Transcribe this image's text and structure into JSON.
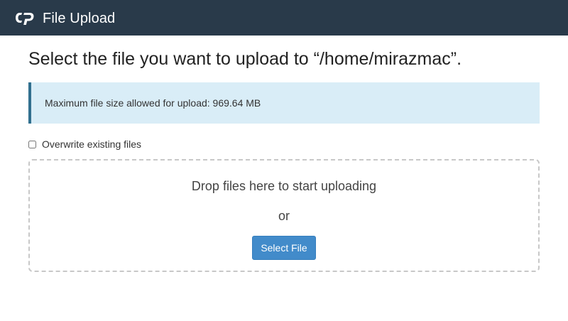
{
  "header": {
    "logo_icon": "cpanel-logo-icon",
    "title": "File Upload",
    "background_color": "#293a4a"
  },
  "main": {
    "page_title": "Select the file you want to upload to “/home/mirazmac”.",
    "info": {
      "text": "Maximum file size allowed for upload: 969.64 MB",
      "background_color": "#d9edf7",
      "accent_color": "#31708f"
    },
    "overwrite": {
      "label": "Overwrite existing files",
      "checked": false
    },
    "dropzone": {
      "drop_text": "Drop files here to start uploading",
      "or_text": "or",
      "select_button_label": "Select File",
      "button_color": "#428bca"
    }
  }
}
